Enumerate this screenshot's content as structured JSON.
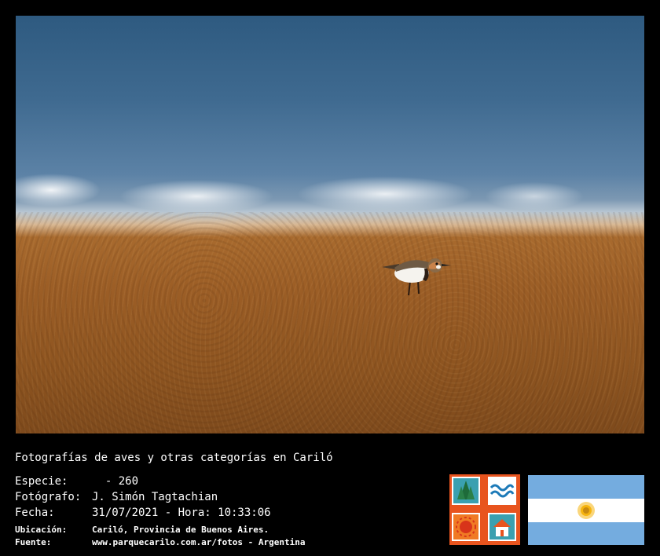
{
  "caption": "Fotografías de aves y otras categorías en Cariló",
  "fields": {
    "especie": {
      "label": "Especie:",
      "value": "  - 260"
    },
    "fotografo": {
      "label": "Fotógrafo:",
      "value": "J. Simón Tagtachian"
    },
    "fecha": {
      "label": "Fecha:",
      "value": "31/07/2021 - Hora: 10:33:06"
    },
    "ubicacion": {
      "label": "Ubicación:",
      "value": "Cariló, Provincia de Buenos Aires."
    },
    "fuente": {
      "label": "Fuente:",
      "value": "www.parquecarilo.com.ar/fotos - Argentina"
    }
  },
  "logo_icons": [
    "pine-trees-icon",
    "waves-icon",
    "sun-icon",
    "house-icon"
  ],
  "flag": "argentina-flag",
  "colors": {
    "background": "#000000",
    "logo_orange": "#e8541e",
    "flag_blue": "#74acdf"
  }
}
